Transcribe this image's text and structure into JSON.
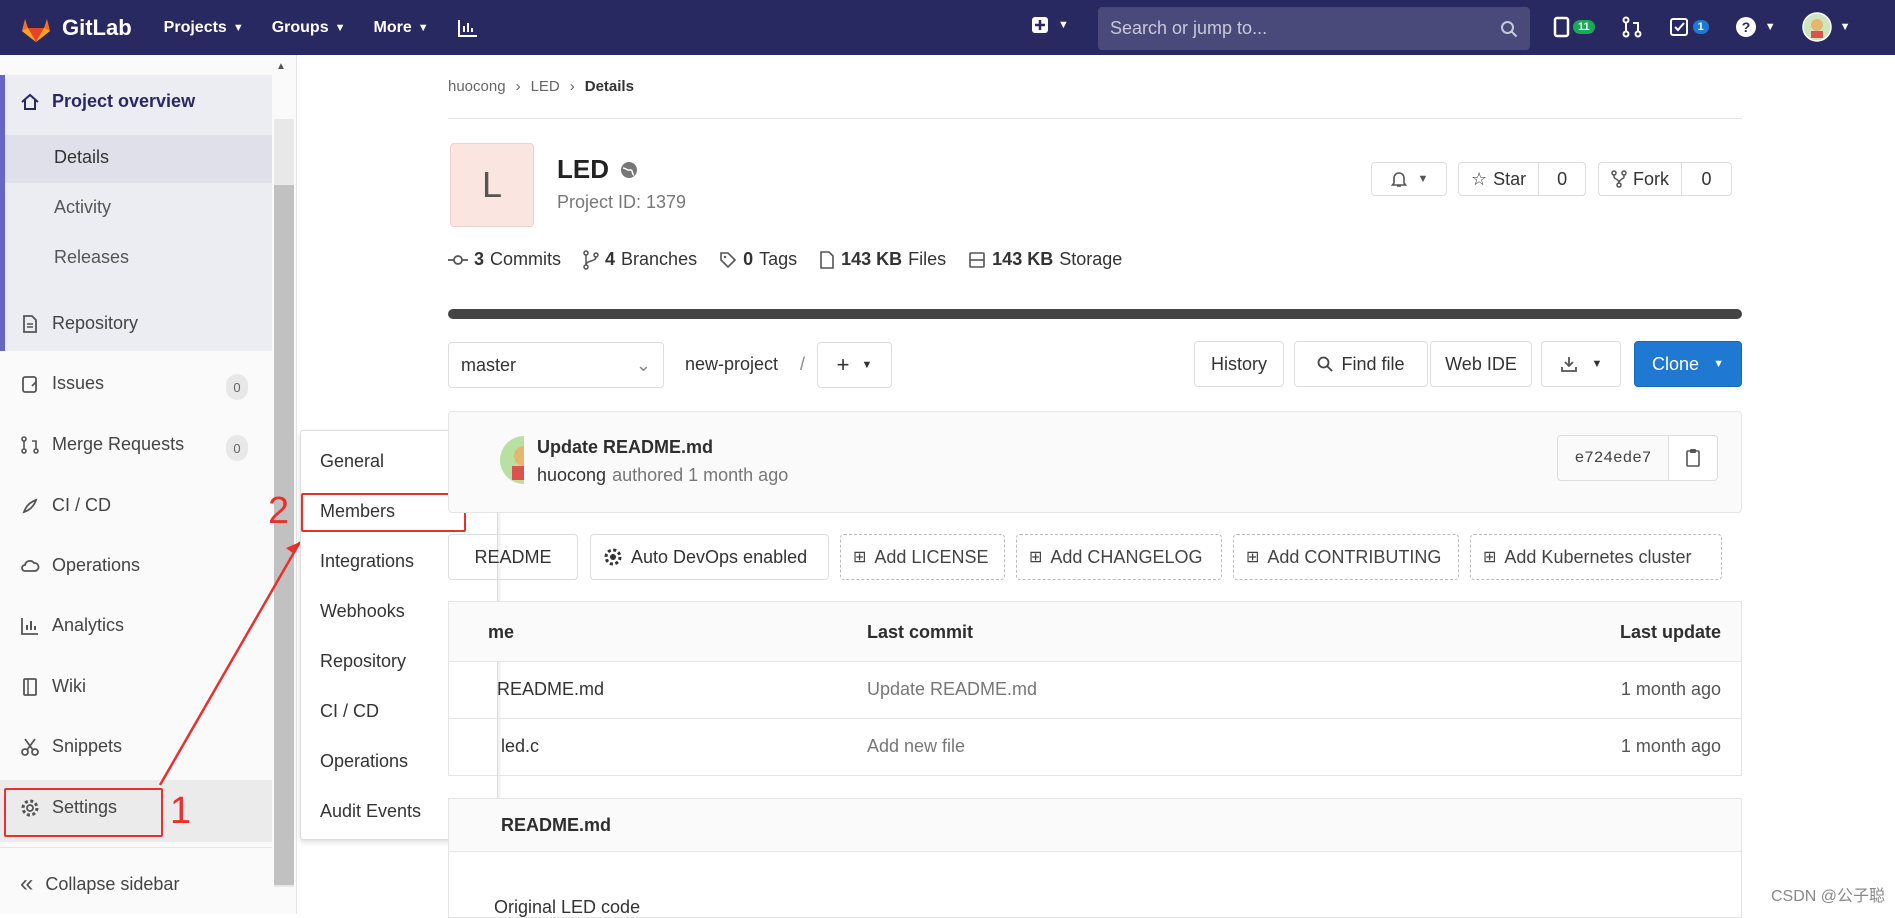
{
  "topbar": {
    "brand": "GitLab",
    "nav": [
      "Projects",
      "Groups",
      "More"
    ],
    "search_placeholder": "Search or jump to...",
    "todo_count": "11",
    "issues_count": "1",
    "colors": {
      "bar": "#292961",
      "green": "#1aaa55",
      "blue": "#1f78d1"
    }
  },
  "sidebar": {
    "header": "Project overview",
    "subitems": [
      "Details",
      "Activity",
      "Releases"
    ],
    "items": [
      {
        "label": "Repository",
        "icon": "doc-icon"
      },
      {
        "label": "Issues",
        "icon": "issues-icon",
        "badge": "0"
      },
      {
        "label": "Merge Requests",
        "icon": "merge-icon",
        "badge": "0"
      },
      {
        "label": "CI / CD",
        "icon": "rocket-icon"
      },
      {
        "label": "Operations",
        "icon": "cloud-icon"
      },
      {
        "label": "Analytics",
        "icon": "chart-icon"
      },
      {
        "label": "Wiki",
        "icon": "book-icon"
      },
      {
        "label": "Snippets",
        "icon": "scissors-icon"
      },
      {
        "label": "Settings",
        "icon": "gear-icon"
      }
    ],
    "collapse": "Collapse sidebar"
  },
  "flyout": [
    "General",
    "Members",
    "Integrations",
    "Webhooks",
    "Repository",
    "CI / CD",
    "Operations",
    "Audit Events"
  ],
  "annotations": {
    "one": "1",
    "two": "2"
  },
  "breadcrumb": [
    "huocong",
    "LED",
    "Details"
  ],
  "project": {
    "avatar_letter": "L",
    "name": "LED",
    "id_text": "Project ID: 1379",
    "star": "Star",
    "star_count": "0",
    "fork": "Fork",
    "fork_count": "0"
  },
  "stats": {
    "commits_n": "3",
    "commits": "Commits",
    "branches_n": "4",
    "branches": "Branches",
    "tags_n": "0",
    "tags": "Tags",
    "files_n": "143 KB",
    "files": "Files",
    "storage_n": "143 KB",
    "storage": "Storage"
  },
  "repo": {
    "branch": "master",
    "path": "new-project",
    "slash": "/",
    "history": "History",
    "find": "Find file",
    "webide": "Web IDE",
    "clone": "Clone"
  },
  "commit": {
    "title": "Update README.md",
    "author": "huocong",
    "authored": "authored 1 month ago",
    "sha": "e724ede7"
  },
  "buttons": {
    "readme": "README",
    "autodevops": "Auto DevOps enabled",
    "license": "Add LICENSE",
    "changelog": "Add CHANGELOG",
    "contributing": "Add CONTRIBUTING",
    "k8s": "Add Kubernetes cluster"
  },
  "table": {
    "headers": [
      "me",
      "Last commit",
      "Last update"
    ],
    "rows": [
      {
        "name": "README.md",
        "commit": "Update README.md",
        "update": "1 month ago"
      },
      {
        "name": "led.c",
        "commit": "Add new file",
        "update": "1 month ago"
      }
    ]
  },
  "readme": {
    "title": "README.md",
    "body": "Original LED code"
  },
  "watermark": "CSDN @公子聪"
}
